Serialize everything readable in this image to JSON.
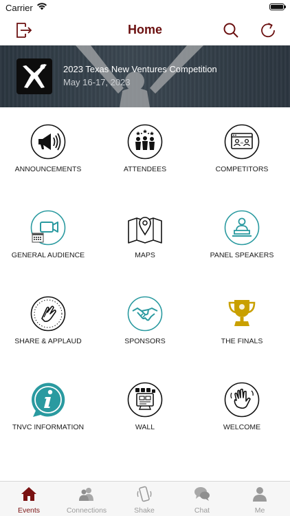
{
  "status_bar": {
    "carrier": "Carrier"
  },
  "nav": {
    "title": "Home",
    "logout_icon": "logout-icon",
    "search_icon": "search-icon",
    "refresh_icon": "refresh-icon",
    "accent_color": "#6b1010"
  },
  "event": {
    "title": "2023 Texas New Ventures Competition",
    "dates": "May 16-17, 2023"
  },
  "tiles": [
    {
      "label": "ANNOUNCEMENTS",
      "icon": "megaphone-icon"
    },
    {
      "label": "ATTENDEES",
      "icon": "attendees-icon"
    },
    {
      "label": "COMPETITORS",
      "icon": "competitors-icon"
    },
    {
      "label": "GENERAL AUDIENCE",
      "icon": "video-calendar-icon"
    },
    {
      "label": "MAPS",
      "icon": "map-icon"
    },
    {
      "label": "PANEL SPEAKERS",
      "icon": "speaker-icon"
    },
    {
      "label": "SHARE & APPLAUD",
      "icon": "applause-icon"
    },
    {
      "label": "SPONSORS",
      "icon": "handshake-icon"
    },
    {
      "label": "THE FINALS",
      "icon": "trophy-icon"
    },
    {
      "label": "TNVC INFORMATION",
      "icon": "info-icon"
    },
    {
      "label": "WALL",
      "icon": "social-wall-icon"
    },
    {
      "label": "WELCOME",
      "icon": "waving-hand-icon"
    }
  ],
  "tab_bar": {
    "tabs": [
      {
        "label": "Events",
        "icon": "house-icon",
        "active": true
      },
      {
        "label": "Connections",
        "icon": "people-icon",
        "active": false
      },
      {
        "label": "Shake",
        "icon": "shake-phone-icon",
        "active": false
      },
      {
        "label": "Chat",
        "icon": "chat-bubbles-icon",
        "active": false
      },
      {
        "label": "Me",
        "icon": "person-icon",
        "active": false
      }
    ],
    "active_color": "#7a1212",
    "inactive_color": "#9a9a9a"
  },
  "colors": {
    "teal": "#2a9aa0",
    "gold": "#c9a000"
  }
}
